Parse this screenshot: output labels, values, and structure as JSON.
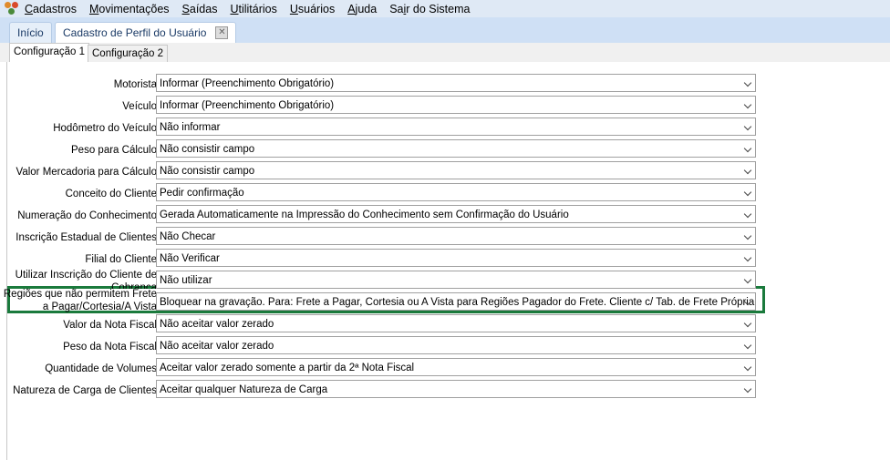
{
  "menu": [
    "Cadastros",
    "Movimentações",
    "Saídas",
    "Utilitários",
    "Usuários",
    "Ajuda",
    "Sair do Sistema"
  ],
  "menu_mnemonic": [
    "C",
    "M",
    "S",
    "U",
    "U",
    "A",
    "i"
  ],
  "tabs": {
    "home": "Início",
    "profile": "Cadastro de Perfil do Usuário"
  },
  "subtabs": [
    "Configuração 1",
    "Configuração 2"
  ],
  "highlight_color": "#1a7a3c",
  "fields": [
    {
      "label": "Motorista",
      "value": "Informar (Preenchimento Obrigatório)"
    },
    {
      "label": "Veículo",
      "value": "Informar (Preenchimento Obrigatório)"
    },
    {
      "label": "Hodômetro do Veículo",
      "value": "Não informar"
    },
    {
      "label": "Peso para Cálculo",
      "value": "Não consistir campo"
    },
    {
      "label": "Valor Mercadoria para Cálculo",
      "value": "Não consistir campo"
    },
    {
      "label": "Conceito do Cliente",
      "value": "Pedir confirmação"
    },
    {
      "label": "Numeração do Conhecimento",
      "value": "Gerada Automaticamente na Impressão do Conhecimento sem Confirmação do Usuário"
    },
    {
      "label": "Inscrição Estadual de Clientes",
      "value": "Não Checar"
    },
    {
      "label": "Filial do Cliente",
      "value": "Não Verificar"
    },
    {
      "label": "Utilizar Inscrição do Cliente de Cobrança",
      "value": "Não utilizar"
    },
    {
      "label": "Regiões que não permitem Frete  a Pagar/Cortesia/A Vista",
      "value": "Bloquear na gravação. Para: Frete a Pagar, Cortesia ou A Vista para Regiões Pagador do Frete. Cliente c/ Tab. de Frete Própria"
    },
    {
      "label": "Valor da Nota Fiscal",
      "value": "Não aceitar valor zerado"
    },
    {
      "label": "Peso da Nota Fiscal",
      "value": "Não aceitar valor zerado"
    },
    {
      "label": "Quantidade de Volumes",
      "value": "Aceitar valor zerado somente a partir da 2ª Nota Fiscal"
    },
    {
      "label": "Natureza de Carga de Clientes",
      "value": "Aceitar qualquer Natureza de Carga"
    }
  ]
}
